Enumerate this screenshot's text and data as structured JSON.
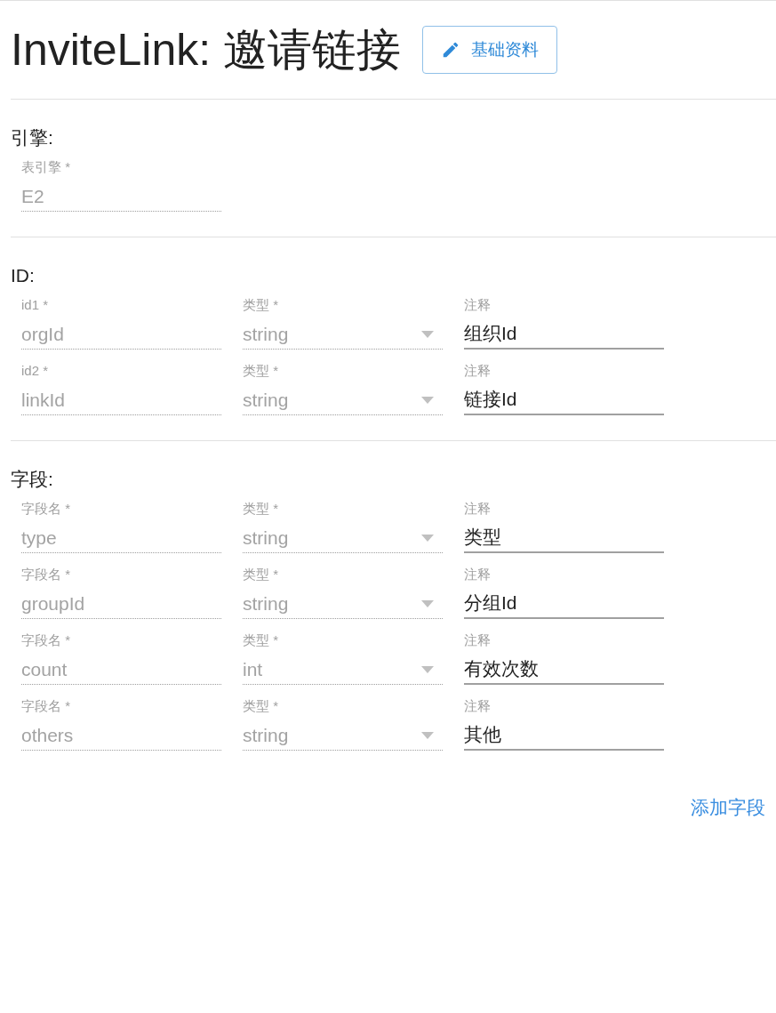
{
  "title": "InviteLink: 邀请链接",
  "edit_button": {
    "label": "基础资料"
  },
  "sections": [
    {
      "heading": "引擎:",
      "rows": [
        {
          "fields": [
            {
              "kind": "text",
              "label": "表引擎 *",
              "value": "E2",
              "disabled": true
            }
          ]
        }
      ]
    },
    {
      "heading": "ID:",
      "rows": [
        {
          "fields": [
            {
              "kind": "text",
              "label": "id1 *",
              "value": "orgId",
              "disabled": true
            },
            {
              "kind": "select",
              "label": "类型 *",
              "value": "string",
              "disabled": true
            },
            {
              "kind": "text",
              "label": "注释",
              "value": "组织Id",
              "disabled": false
            }
          ]
        },
        {
          "fields": [
            {
              "kind": "text",
              "label": "id2 *",
              "value": "linkId",
              "disabled": true
            },
            {
              "kind": "select",
              "label": "类型 *",
              "value": "string",
              "disabled": true
            },
            {
              "kind": "text",
              "label": "注释",
              "value": "链接Id",
              "disabled": false
            }
          ]
        }
      ]
    },
    {
      "heading": "字段:",
      "rows": [
        {
          "fields": [
            {
              "kind": "text",
              "label": "字段名 *",
              "value": "type",
              "disabled": true
            },
            {
              "kind": "select",
              "label": "类型 *",
              "value": "string",
              "disabled": true
            },
            {
              "kind": "text",
              "label": "注释",
              "value": "类型",
              "disabled": false
            }
          ]
        },
        {
          "fields": [
            {
              "kind": "text",
              "label": "字段名 *",
              "value": "groupId",
              "disabled": true
            },
            {
              "kind": "select",
              "label": "类型 *",
              "value": "string",
              "disabled": true
            },
            {
              "kind": "text",
              "label": "注释",
              "value": "分组Id",
              "disabled": false
            }
          ]
        },
        {
          "fields": [
            {
              "kind": "text",
              "label": "字段名 *",
              "value": "count",
              "disabled": true
            },
            {
              "kind": "select",
              "label": "类型 *",
              "value": "int",
              "disabled": true
            },
            {
              "kind": "text",
              "label": "注释",
              "value": "有效次数",
              "disabled": false
            }
          ]
        },
        {
          "fields": [
            {
              "kind": "text",
              "label": "字段名 *",
              "value": "others",
              "disabled": true
            },
            {
              "kind": "select",
              "label": "类型 *",
              "value": "string",
              "disabled": true
            },
            {
              "kind": "text",
              "label": "注释",
              "value": "其他",
              "disabled": false
            }
          ]
        }
      ]
    }
  ],
  "add_button": {
    "label": "添加字段"
  }
}
